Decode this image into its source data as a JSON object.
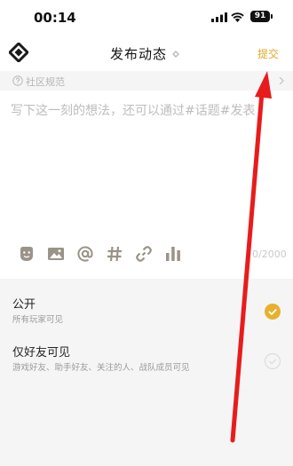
{
  "status_bar": {
    "time": "00:14",
    "battery": "91"
  },
  "header": {
    "title": "发布动态",
    "submit_label": "提交"
  },
  "guidelines": {
    "label": "社区规范"
  },
  "composer": {
    "placeholder": "写下这一刻的想法，还可以通过#话题#发表",
    "char_count": "0/2000",
    "tools": [
      "emoji-icon",
      "image-icon",
      "mention-icon",
      "hashtag-icon",
      "link-icon",
      "chart-icon"
    ]
  },
  "visibility": {
    "options": [
      {
        "title": "公开",
        "subtitle": "所有玩家可见",
        "selected": true
      },
      {
        "title": "仅好友可见",
        "subtitle": "游戏好友、助手好友、关注的人、战队成员可见",
        "selected": false
      }
    ]
  },
  "colors": {
    "accent": "#e3a92a",
    "arrow": "#e81c1c"
  }
}
